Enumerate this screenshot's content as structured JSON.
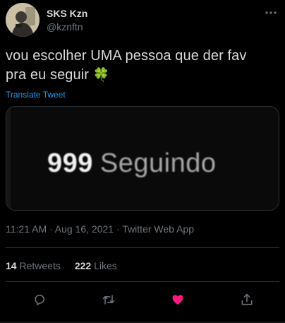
{
  "author": {
    "display_name": "SKS Kzn",
    "handle": "@kznftn"
  },
  "tweet": {
    "text_line1": "vou escolher UMA pessoa que der fav",
    "text_line2": "pra eu seguir",
    "emoji": "🍀",
    "translate_label": "Translate Tweet"
  },
  "media": {
    "count": "999",
    "label": "Seguindo"
  },
  "meta": {
    "time": "11:21 AM",
    "sep1": " · ",
    "date": "Aug 16, 2021",
    "sep2": " · ",
    "source": "Twitter Web App"
  },
  "stats": {
    "retweets_count": "14",
    "retweets_label": "Retweets",
    "likes_count": "222",
    "likes_label": "Likes"
  },
  "icons": {
    "more": "more-icon",
    "reply": "reply-icon",
    "retweet": "retweet-icon",
    "like": "heart-icon",
    "share": "share-icon"
  },
  "colors": {
    "background": "#000000",
    "text": "#d9d9d9",
    "secondary": "#6e767d",
    "link": "#1d9bf0",
    "like": "#f91880",
    "divider": "#2f3336"
  }
}
